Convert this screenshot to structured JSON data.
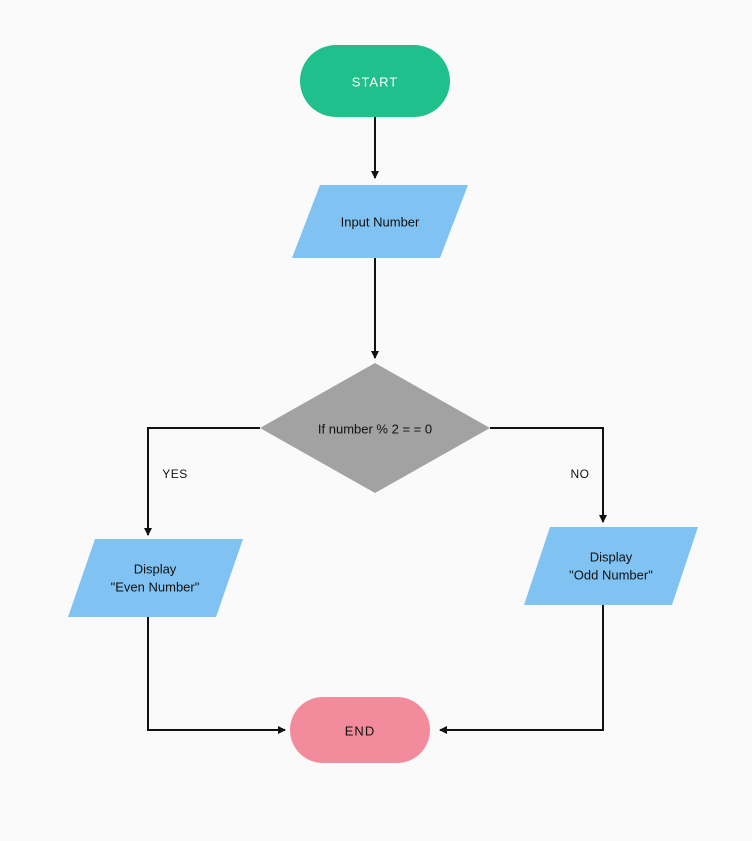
{
  "flowchart": {
    "start": {
      "label": "START"
    },
    "input": {
      "label": "Input Number"
    },
    "decision": {
      "label": "If number % 2 = = 0"
    },
    "branch_yes": {
      "label": "YES"
    },
    "branch_no": {
      "label": "NO"
    },
    "display_even": {
      "line1": "Display",
      "line2": "\"Even Number\""
    },
    "display_odd": {
      "line1": "Display",
      "line2": "\"Odd Number\""
    },
    "end": {
      "label": "END"
    }
  },
  "colors": {
    "start_fill": "#1fc08b",
    "input_fill": "#80c3f3",
    "decision_fill": "#a2a2a2",
    "end_fill": "#f28b9b",
    "stroke": "#111111",
    "bg": "#fafafa"
  }
}
